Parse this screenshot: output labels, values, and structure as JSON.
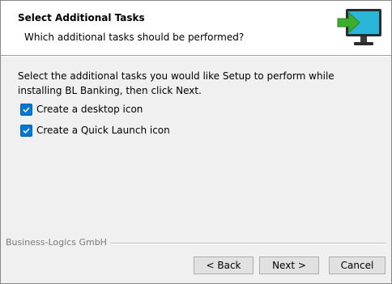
{
  "header": {
    "title": "Select Additional Tasks",
    "subtitle": "Which additional tasks should be performed?",
    "icon": "computer-install-icon"
  },
  "body": {
    "intro": "Select the additional tasks you would like Setup to perform while installing BL Banking, then click Next.",
    "tasks": [
      {
        "label": "Create a desktop icon",
        "checked": true
      },
      {
        "label": "Create a Quick Launch icon",
        "checked": true
      }
    ]
  },
  "footer": {
    "brand": "Business-Logics GmbH",
    "back_label": "< Back",
    "next_label": "Next >",
    "cancel_label": "Cancel"
  },
  "colors": {
    "checkbox_accent": "#0078d7",
    "icon_green": "#3dae2b",
    "icon_screen": "#29b6d8"
  }
}
